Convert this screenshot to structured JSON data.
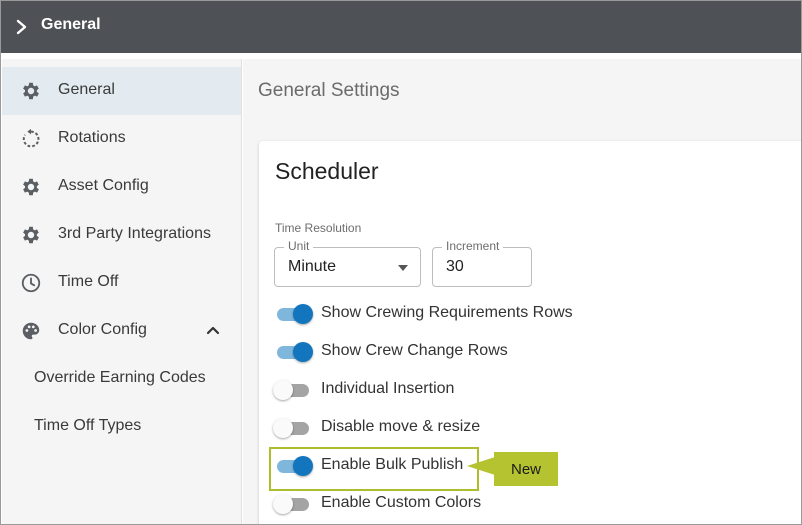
{
  "topbar": {
    "title": "General"
  },
  "sidebar": {
    "items": [
      {
        "label": "General",
        "icon": "gear-icon",
        "active": true
      },
      {
        "label": "Rotations",
        "icon": "rotate-icon"
      },
      {
        "label": "Asset Config",
        "icon": "gear-icon"
      },
      {
        "label": "3rd Party Integrations",
        "icon": "gear-icon"
      },
      {
        "label": "Time Off",
        "icon": "clock-icon"
      },
      {
        "label": "Color Config",
        "icon": "palette-icon",
        "expanded": true
      },
      {
        "label": "Override Earning Codes"
      },
      {
        "label": "Time Off Types"
      }
    ]
  },
  "main": {
    "title": "General Settings",
    "card": {
      "title": "Scheduler",
      "time_resolution": {
        "label": "Time Resolution",
        "unit": {
          "legend": "Unit",
          "value": "Minute"
        },
        "increment": {
          "legend": "Increment",
          "value": "30"
        }
      },
      "toggles": [
        {
          "label": "Show Crewing Requirements Rows",
          "on": true
        },
        {
          "label": "Show Crew Change Rows",
          "on": true
        },
        {
          "label": "Individual Insertion",
          "on": false
        },
        {
          "label": "Disable move & resize",
          "on": false
        },
        {
          "label": "Enable Bulk Publish",
          "on": true
        },
        {
          "label": "Enable Custom Colors",
          "on": false
        }
      ]
    }
  },
  "callout": {
    "label": "New"
  },
  "colors": {
    "topbar": "#4e5155",
    "toggle_on": "#1275be",
    "highlight": "#aebd2d",
    "badge": "#b5c330"
  }
}
